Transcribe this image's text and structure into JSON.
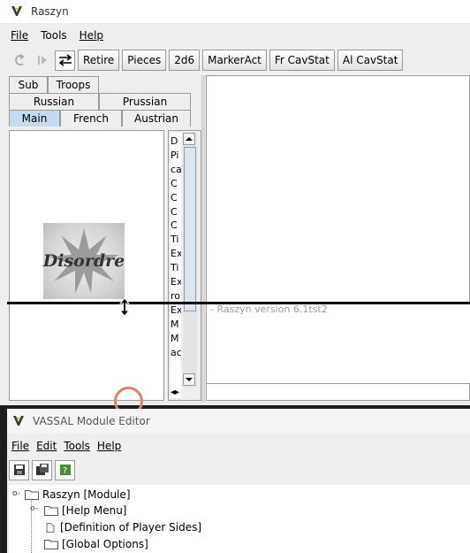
{
  "main_window": {
    "title": "Raszyn",
    "menus": [
      "File",
      "Tools",
      "Help"
    ],
    "toolbar_buttons": [
      "Retire",
      "Pieces",
      "2d6",
      "MarkerAct",
      "Fr CavStat",
      "Al CavStat"
    ],
    "tabs_row1": [
      "Sub",
      "Troops"
    ],
    "tabs_row2": [
      "Russian",
      "Prussian"
    ],
    "tabs_row3": [
      "Main",
      "French",
      "Austrian"
    ],
    "selected_tab": "Main",
    "piece_image_text": "Disordre",
    "piece_list_letters": [
      "D",
      "Pi",
      "ca",
      "C",
      "C",
      "C",
      "C",
      "Ti",
      "Ex",
      "Ti",
      "Ex",
      "ro",
      "Ex",
      "M",
      "M",
      "ac"
    ],
    "chat_message": "- Raszyn version 6.1tst2"
  },
  "editor_window": {
    "title": "VASSAL Module Editor",
    "menus": [
      "File",
      "Edit",
      "Tools",
      "Help"
    ],
    "tree": [
      {
        "label": "Raszyn [Module]",
        "icon": "folder-icon"
      },
      {
        "label": "[Help Menu]",
        "icon": "folder-icon"
      },
      {
        "label": "[Definition of Player Sides]",
        "icon": "document-icon"
      },
      {
        "label": "[Global Options]",
        "icon": "folder-icon"
      }
    ]
  },
  "colors": {
    "accent": "#c6daf0",
    "cursor_circle": "#d9856a"
  }
}
